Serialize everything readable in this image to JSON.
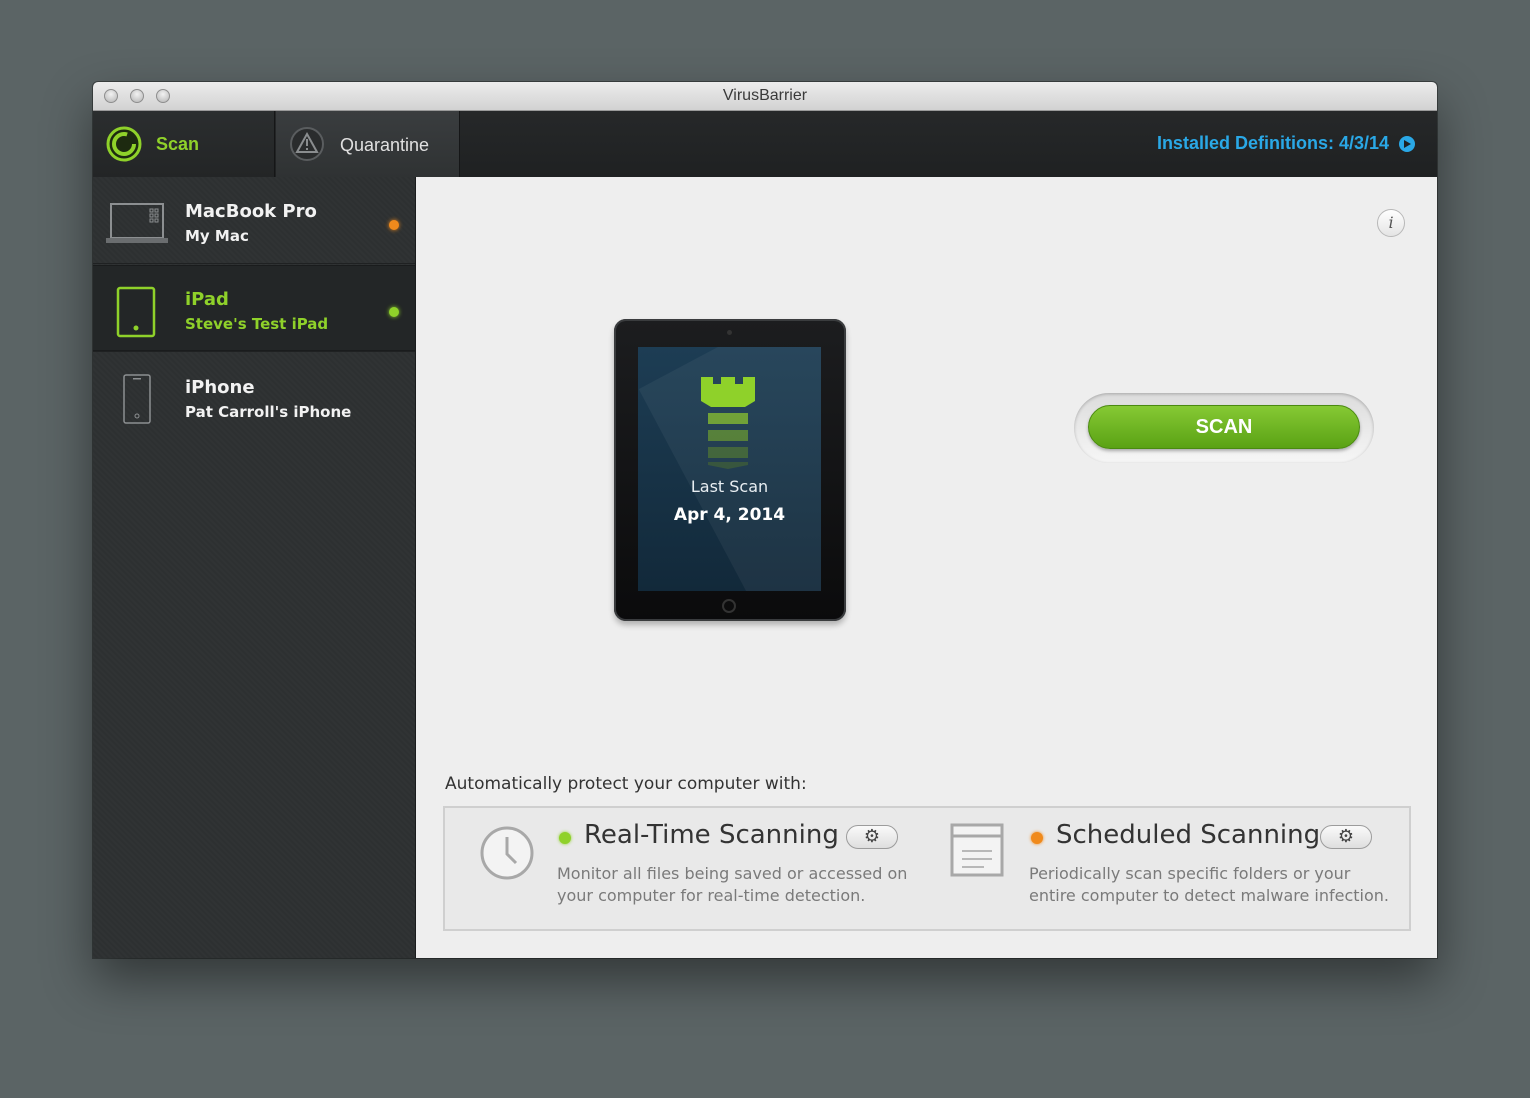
{
  "window": {
    "title": "VirusBarrier"
  },
  "tabs": [
    {
      "label": "Scan",
      "icon": "power-ring-icon",
      "active": true,
      "color": "#8fd12a"
    },
    {
      "label": "Quarantine",
      "icon": "warning-triangle-icon",
      "active": false,
      "color": "#e0e0e0"
    }
  ],
  "definitions": {
    "label": "Installed Definitions: 4/3/14",
    "color": "#2aa8e6"
  },
  "devices": [
    {
      "name": "MacBook Pro",
      "subtitle": "My Mac",
      "icon": "laptop-icon",
      "status_color": "#f08a1c",
      "selected": false
    },
    {
      "name": "iPad",
      "subtitle": "Steve's Test iPad",
      "icon": "tablet-icon",
      "status_color": "#8fd12a",
      "selected": true
    },
    {
      "name": "iPhone",
      "subtitle": "Pat Carroll's iPhone",
      "icon": "phone-icon",
      "status_color": null,
      "selected": false
    }
  ],
  "main": {
    "info_icon": "info-icon",
    "device_preview": {
      "label": "Last Scan",
      "date": "Apr 4, 2014",
      "icon": "tower-icon"
    },
    "scan_button": "SCAN",
    "auto_protect_label": "Automatically protect your computer with:",
    "features": [
      {
        "title": "Real-Time Scanning",
        "description": "Monitor all files being saved or accessed on your computer for real-time detection.",
        "icon": "clock-icon",
        "status_color": "#8fd12a"
      },
      {
        "title": "Scheduled Scanning",
        "description": "Periodically scan specific folders or your entire computer to detect malware infection.",
        "icon": "calendar-list-icon",
        "status_color": "#f08a1c"
      }
    ]
  }
}
